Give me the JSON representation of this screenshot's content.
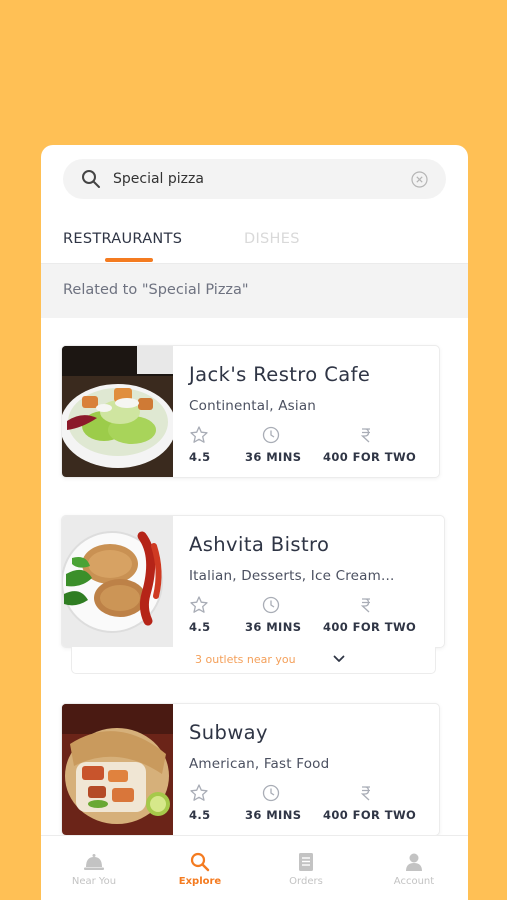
{
  "search": {
    "value": "Special pizza",
    "placeholder": "Search"
  },
  "tabs": [
    {
      "label": "RESTRAURANTS",
      "active": true
    },
    {
      "label": "DISHES",
      "active": false
    }
  ],
  "related_text": "Related to \"Special Pizza\"",
  "restaurants": [
    {
      "name": "Jack's Restro Cafe",
      "cuisine": "Continental, Asian",
      "rating": "4.5",
      "time": "36 MINS",
      "cost": "400 FOR TWO",
      "image": "salad-photo"
    },
    {
      "name": "Ashvita Bistro",
      "cuisine": "Italian, Desserts, Ice Cream...",
      "rating": "4.5",
      "time": "36 MINS",
      "cost": "400 FOR TWO",
      "image": "cutlet-photo",
      "outlets": "3 outlets near you"
    },
    {
      "name": "Subway",
      "cuisine": "American, Fast Food",
      "rating": "4.5",
      "time": "36 MINS",
      "cost": "400 FOR TWO",
      "image": "wrap-photo"
    }
  ],
  "nav": [
    {
      "label": "Near You",
      "icon": "cloche-icon",
      "active": false
    },
    {
      "label": "Explore",
      "icon": "search-icon",
      "active": true
    },
    {
      "label": "Orders",
      "icon": "receipt-icon",
      "active": false
    },
    {
      "label": "Account",
      "icon": "user-icon",
      "active": false
    }
  ],
  "colors": {
    "background": "#FFC055",
    "accent": "#F47B20",
    "text": "#2f3545"
  }
}
